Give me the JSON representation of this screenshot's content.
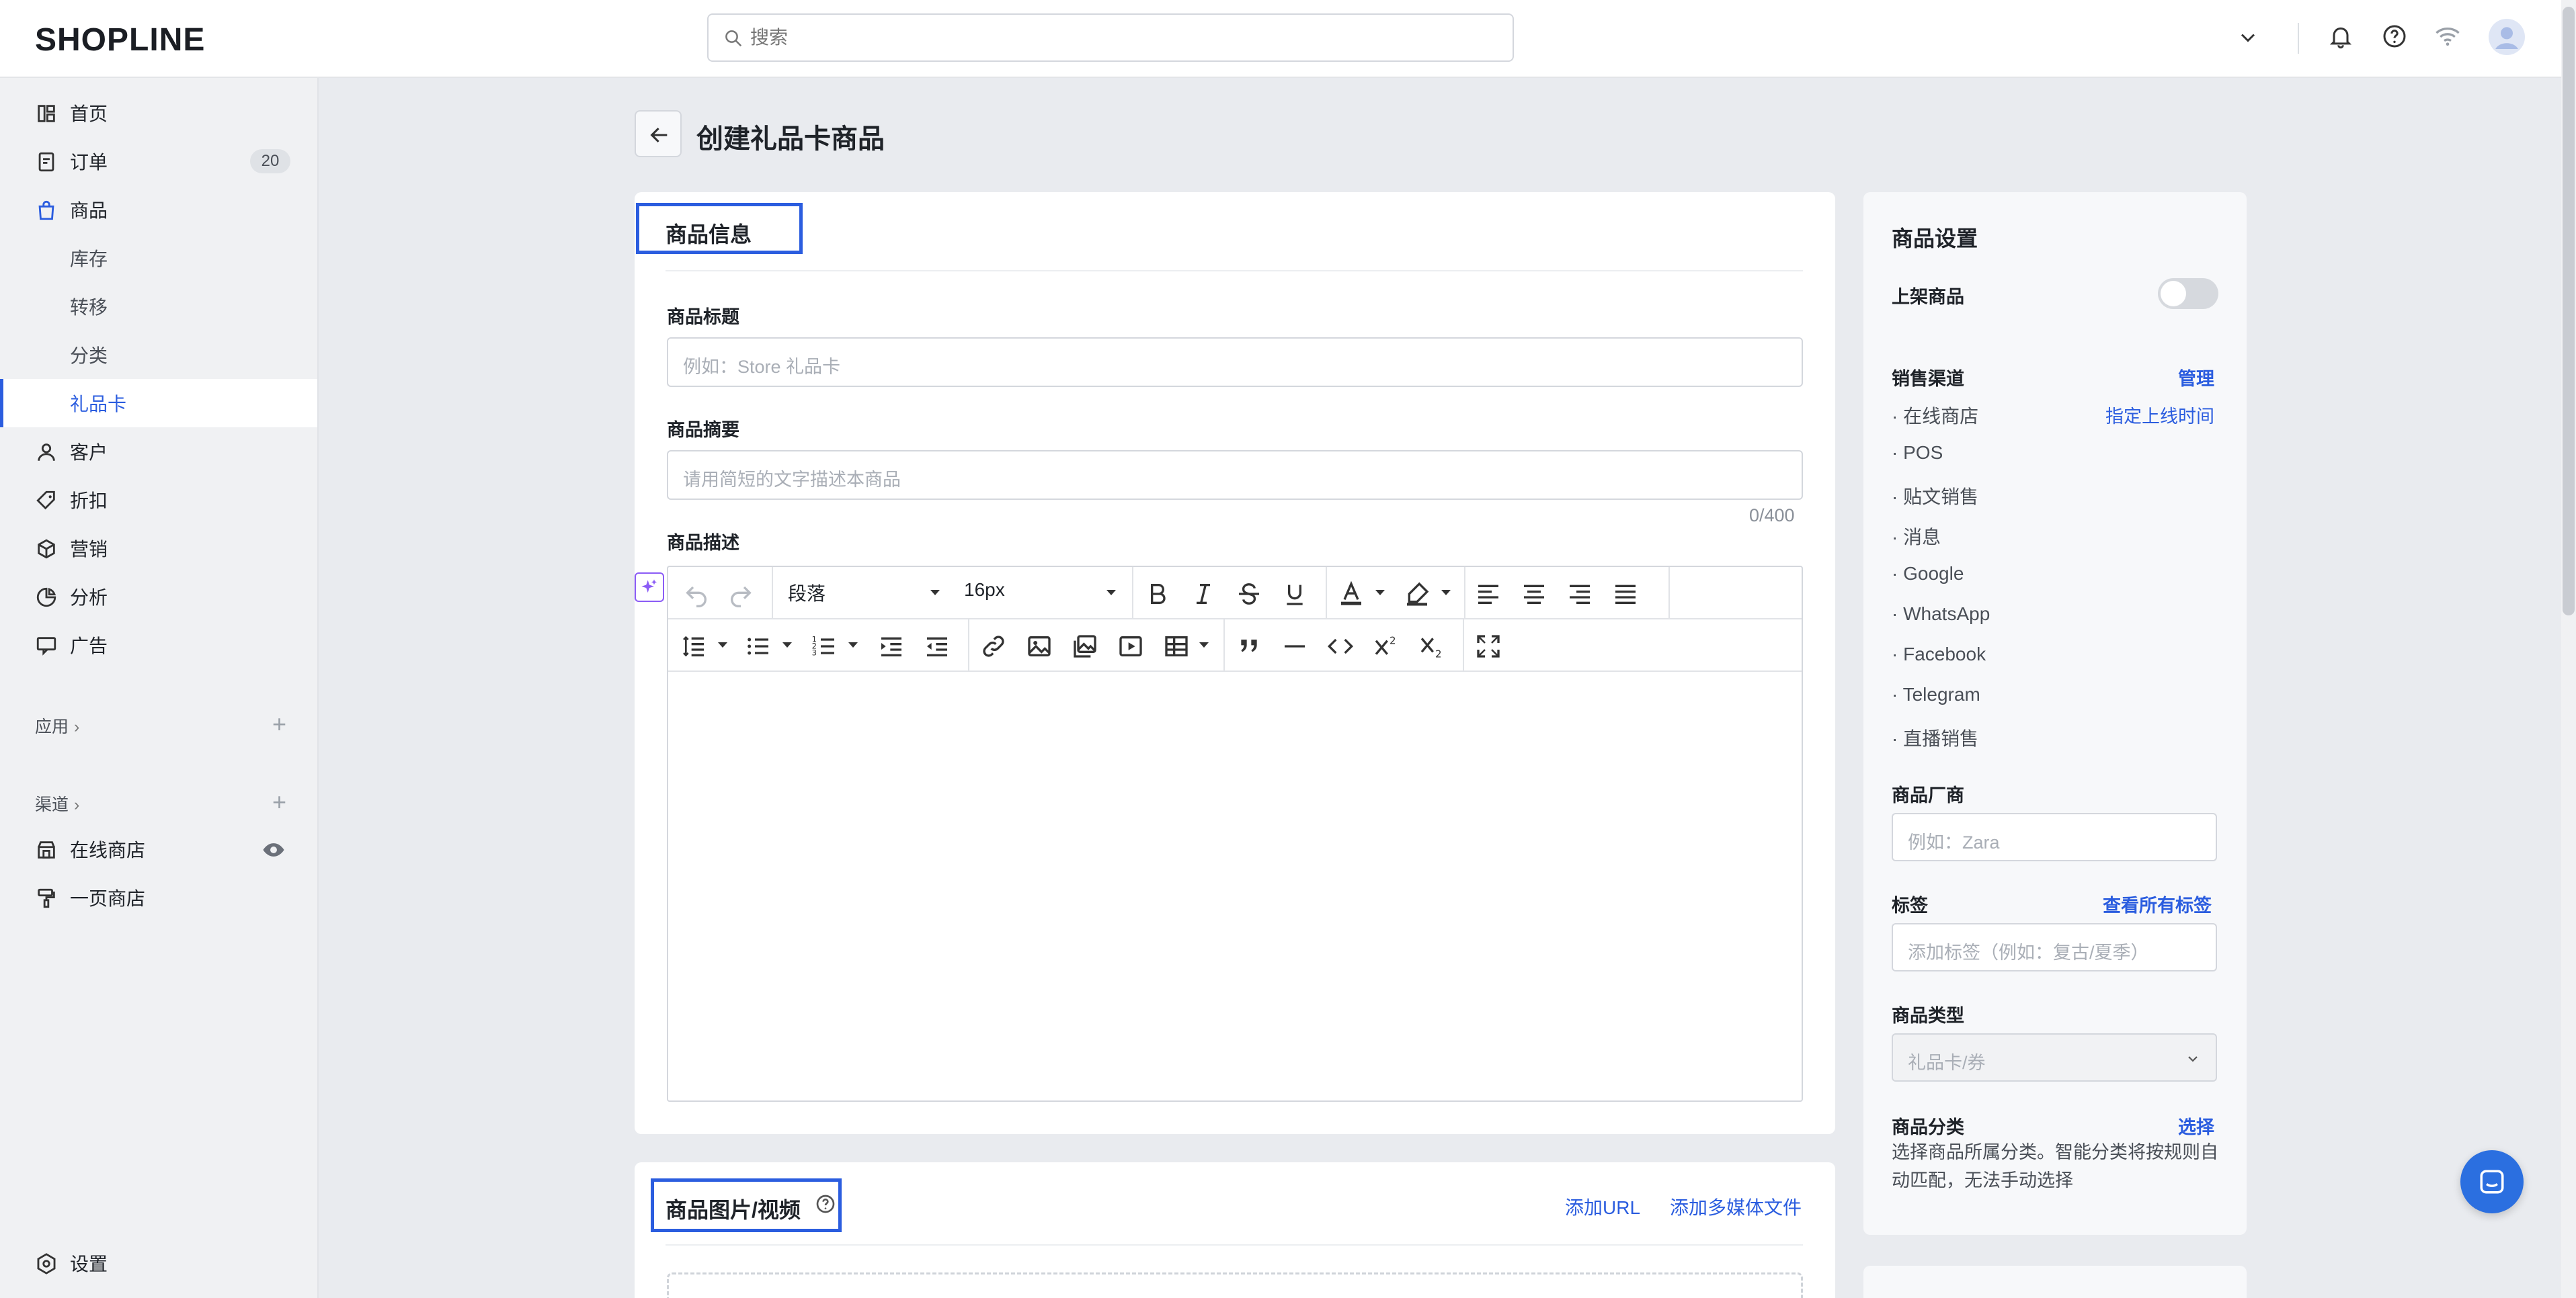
{
  "brand": {
    "logo_bold": "SHOPLINE",
    "logo_rest": ""
  },
  "search": {
    "placeholder": "搜索"
  },
  "sidebar": {
    "items": [
      {
        "label": "首页",
        "icon": "dashboard-icon"
      },
      {
        "label": "订单",
        "icon": "order-icon",
        "badge": "20"
      },
      {
        "label": "商品",
        "icon": "bag-icon"
      },
      {
        "label": "库存"
      },
      {
        "label": "转移"
      },
      {
        "label": "分类"
      },
      {
        "label": "礼品卡"
      },
      {
        "label": "客户",
        "icon": "user-icon"
      },
      {
        "label": "折扣",
        "icon": "tag-icon"
      },
      {
        "label": "营销",
        "icon": "marketing-icon"
      },
      {
        "label": "分析",
        "icon": "analytics-icon"
      },
      {
        "label": "广告",
        "icon": "ads-icon"
      }
    ],
    "apps_section": "应用",
    "channels_section": "渠道",
    "channels": [
      {
        "label": "在线商店"
      },
      {
        "label": "一页商店"
      }
    ],
    "settings": "设置"
  },
  "page": {
    "title": "创建礼品卡商品"
  },
  "product_info": {
    "section_title": "商品信息",
    "title_label": "商品标题",
    "title_placeholder": "例如：Store 礼品卡",
    "summary_label": "商品摘要",
    "summary_placeholder": "请用简短的文字描述本商品",
    "summary_counter": "0/400",
    "description_label": "商品描述",
    "editor": {
      "paragraph": "段落",
      "font_size": "16px"
    }
  },
  "media": {
    "section_title": "商品图片/视频",
    "add_url": "添加URL",
    "add_media": "添加多媒体文件"
  },
  "settings_panel": {
    "title": "商品设置",
    "publish_label": "上架商品",
    "publish_on": false,
    "channels_label": "销售渠道",
    "manage": "管理",
    "schedule": "指定上线时间",
    "channels": [
      "在线商店",
      "POS",
      "贴文销售",
      "消息",
      "Google",
      "WhatsApp",
      "Facebook",
      "Telegram",
      "直播销售"
    ],
    "vendor_label": "商品厂商",
    "vendor_placeholder": "例如：Zara",
    "tags_label": "标签",
    "view_all_tags": "查看所有标签",
    "tags_placeholder": "添加标签（例如：复古/夏季）",
    "type_label": "商品类型",
    "type_value": "礼品卡/券",
    "category_label": "商品分类",
    "category_select": "选择",
    "category_desc": "选择商品所属分类。智能分类将按规则自动匹配，无法手动选择"
  },
  "colors": {
    "accent": "#2b5ddf",
    "highlight_box": "#2b5ddf"
  }
}
